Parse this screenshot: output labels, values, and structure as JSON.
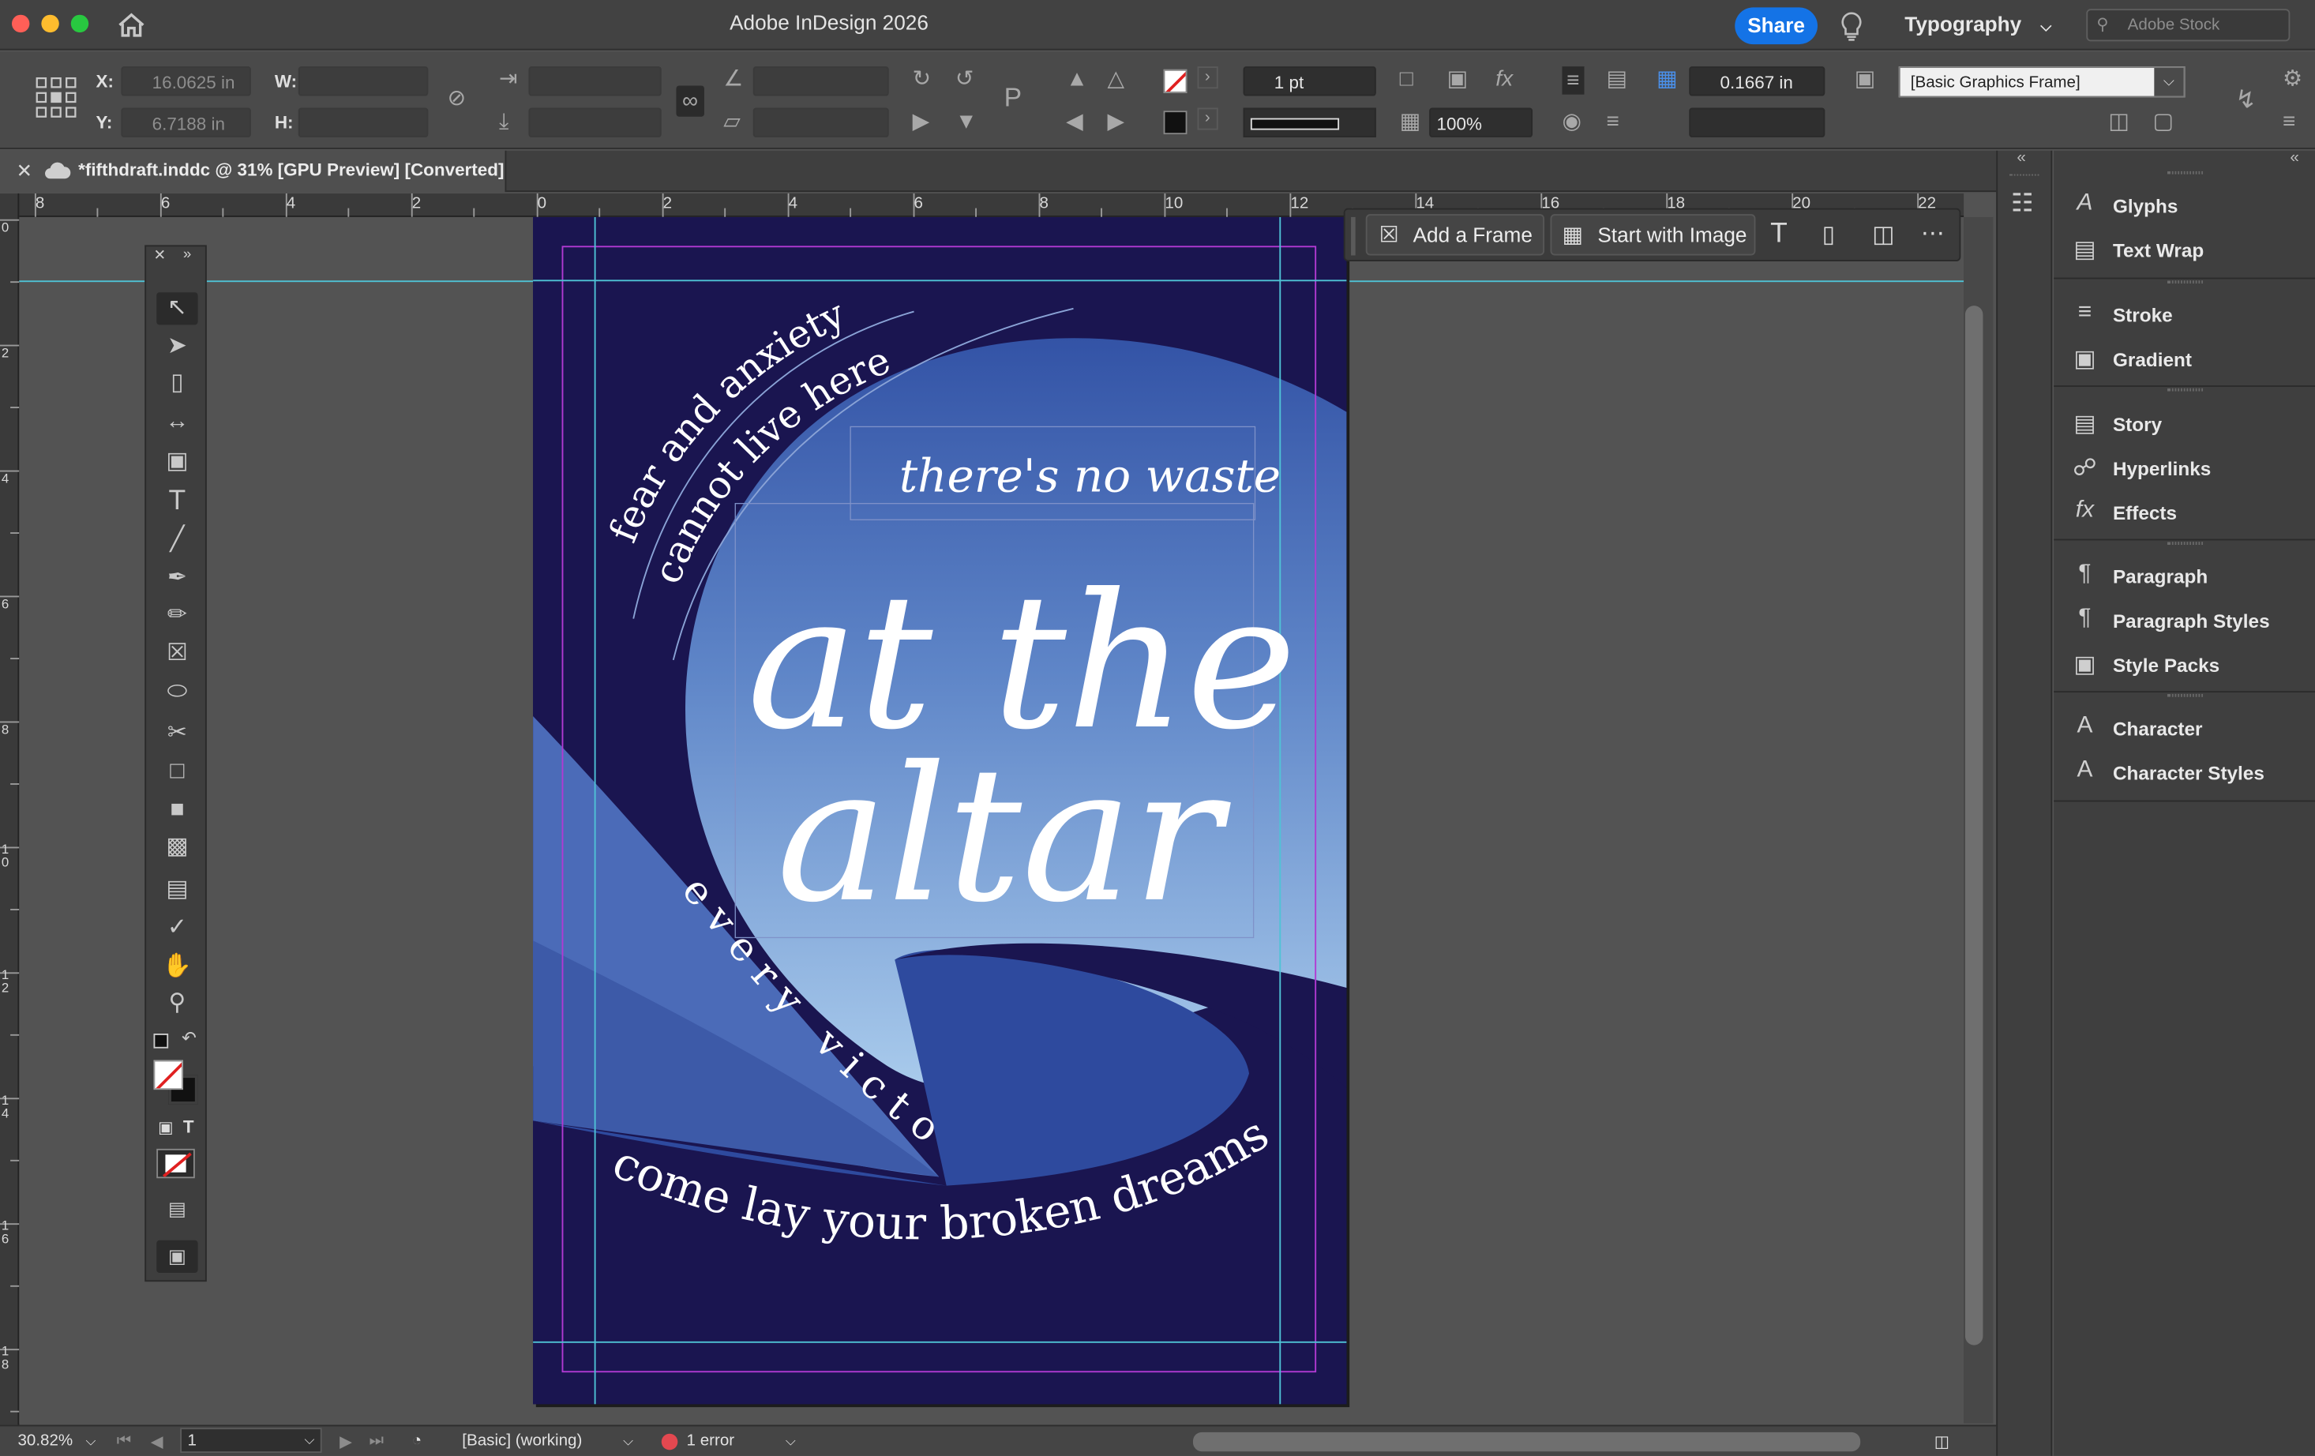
{
  "app": {
    "title": "Adobe InDesign 2026"
  },
  "titlebar": {
    "share_label": "Share",
    "workspace_label": "Typography",
    "stock_placeholder": "Adobe Stock"
  },
  "control_bar": {
    "x_label": "X:",
    "x_value": "16.0625 in",
    "y_label": "Y:",
    "y_value": "6.7188 in",
    "w_label": "W:",
    "h_label": "H:",
    "stroke_weight": "1 pt",
    "opacity": "100%",
    "offset": "0.1667 in",
    "object_style": "[Basic Graphics Frame]"
  },
  "document_tab": {
    "label": "*fifthdraft.inddc @ 31% [GPU Preview] [Converted]"
  },
  "ruler": {
    "horizontal": [
      "8",
      "6",
      "4",
      "2",
      "0",
      "2",
      "4",
      "6",
      "8",
      "10",
      "12",
      "14",
      "16",
      "18",
      "20",
      "22"
    ],
    "vertical": [
      "0",
      "2",
      "4",
      "6",
      "8",
      "10",
      "12",
      "14",
      "16",
      "18"
    ]
  },
  "contextual_taskbar": {
    "add_frame": "Add a Frame",
    "start_with_image": "Start with Image"
  },
  "artwork": {
    "arc_text_1": "fear and anxiety",
    "arc_text_2": "cannot live here",
    "subtitle": "there's no waste",
    "headline_1": "at the",
    "headline_2": "altar",
    "curve_text": "every victory",
    "bottom_text": "come lay your broken dreams",
    "colors": {
      "navy": "#1a1550",
      "royal": "#2e4a9e",
      "mid": "#4b6bb8",
      "sky_top": "#3353a6",
      "sky_bottom": "#a9cbec"
    }
  },
  "statusbar": {
    "zoom": "30.82%",
    "page": "1",
    "preflight_profile": "[Basic] (working)",
    "errors": "1 error"
  },
  "panels": {
    "group1": [
      "Glyphs",
      "Text Wrap"
    ],
    "group2": [
      "Stroke",
      "Gradient"
    ],
    "group3": [
      "Story",
      "Hyperlinks",
      "Effects"
    ],
    "group4": [
      "Paragraph",
      "Paragraph Styles",
      "Style Packs"
    ],
    "group5": [
      "Character",
      "Character Styles"
    ]
  }
}
